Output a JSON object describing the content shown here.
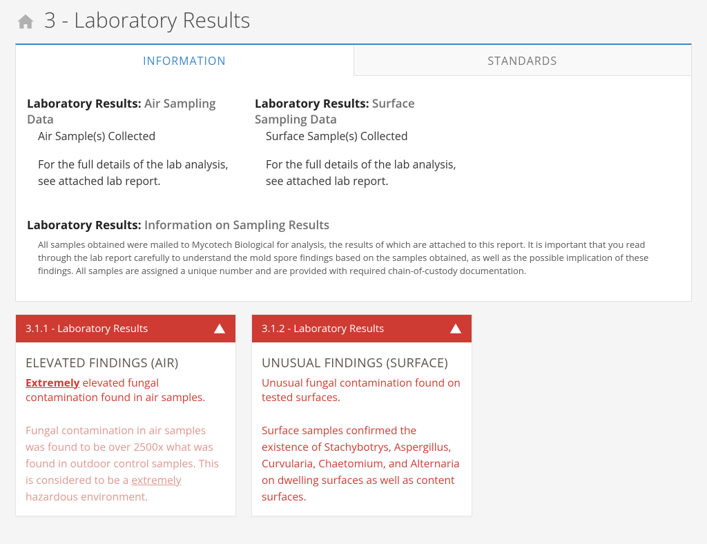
{
  "page_title": "3 - Laboratory Results",
  "tabs": {
    "information": "INFORMATION",
    "standards": "STANDARDS"
  },
  "info": {
    "lead_label": "Laboratory Results: ",
    "air": {
      "sub": "Air Sampling Data",
      "line": "Air Sample(s) Collected",
      "para": "For the full details of the lab analysis, see attached lab report."
    },
    "surface": {
      "sub": "Surface Sampling Data",
      "line": "Surface Sample(s) Collected",
      "para": "For the full details of the lab analysis, see attached lab report."
    },
    "results": {
      "sub": "Information on Sampling Results",
      "para": "All samples obtained were mailed to Mycotech Biological for analysis, the results of which are attached to this report. It is important that you read through the lab report carefully to understand the mold spore findings based on the samples obtained, as well as the possible implication of these findings. All samples are assigned a unique number and are provided with required chain-of-custody documentation."
    }
  },
  "cards": {
    "c1": {
      "hdr": "3.1.1 - Laboratory Results",
      "title": "ELEVATED FINDINGS (AIR)",
      "sum_emph": "Extremely",
      "sum_rest": " elevated fungal contamination found in air samples.",
      "det_a": "Fungal contamination in air samples was found to be over 2500x what was found in outdoor control samples. This is considered to be a ",
      "det_u": "extremely",
      "det_b": " hazardous environment."
    },
    "c2": {
      "hdr": "3.1.2 - Laboratory Results",
      "title": "UNUSUAL FINDINGS (SURFACE)",
      "sum": "Unusual fungal contamination found on tested surfaces.",
      "det": "Surface samples confirmed the existence of Stachybotrys, Aspergillus, Curvularia, Chaetomium, and Alternaria on dwelling surfaces as well as content surfaces."
    }
  }
}
